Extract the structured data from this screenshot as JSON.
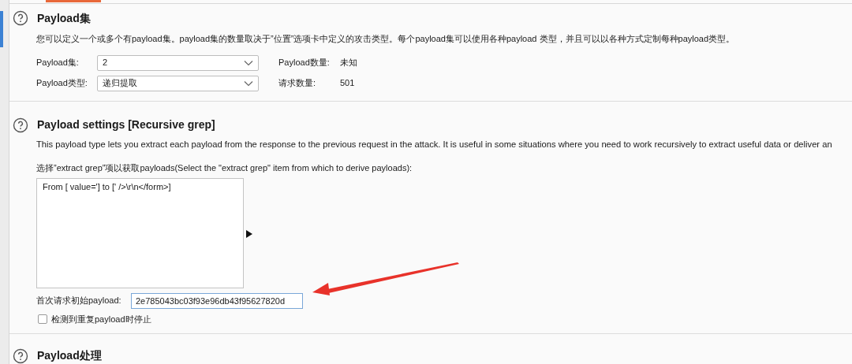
{
  "sections": [
    {
      "title": "Payload集",
      "description": "您可以定义一个或多个有payload集。payload集的数量取决于”位置”选项卡中定义的攻击类型。每个payload集可以使用各种payload 类型，并且可以以各种方式定制每种payload类型。",
      "fields": [
        {
          "label": "Payload集:",
          "value": "2",
          "info_label": "Payload数量:",
          "info_value": "未知"
        },
        {
          "label": "Payload类型:",
          "value": "递归提取",
          "info_label": "请求数量:",
          "info_value": "501"
        }
      ]
    },
    {
      "title": "Payload settings [Recursive grep]",
      "description": "This payload type lets you extract each payload from the response to the previous request in the attack. It is useful in some situations where you need to work recursively to extract useful data or deliver an",
      "list_label": "选择”extract grep”项以获取payloads(Select the \"extract grep\" item from which to derive payloads):",
      "list_items": [
        {
          "text": "From [ value='] to [' />\\r\\n</form>]",
          "selected": false
        }
      ],
      "initial_payload": {
        "label": "首次请求初始payload:",
        "value": "2e785043bc03f93e96db43f95627820d"
      },
      "stop_checkbox": {
        "label": "检测到重复payload时停止",
        "checked": false
      }
    },
    {
      "title": "Payload处理"
    }
  ]
}
